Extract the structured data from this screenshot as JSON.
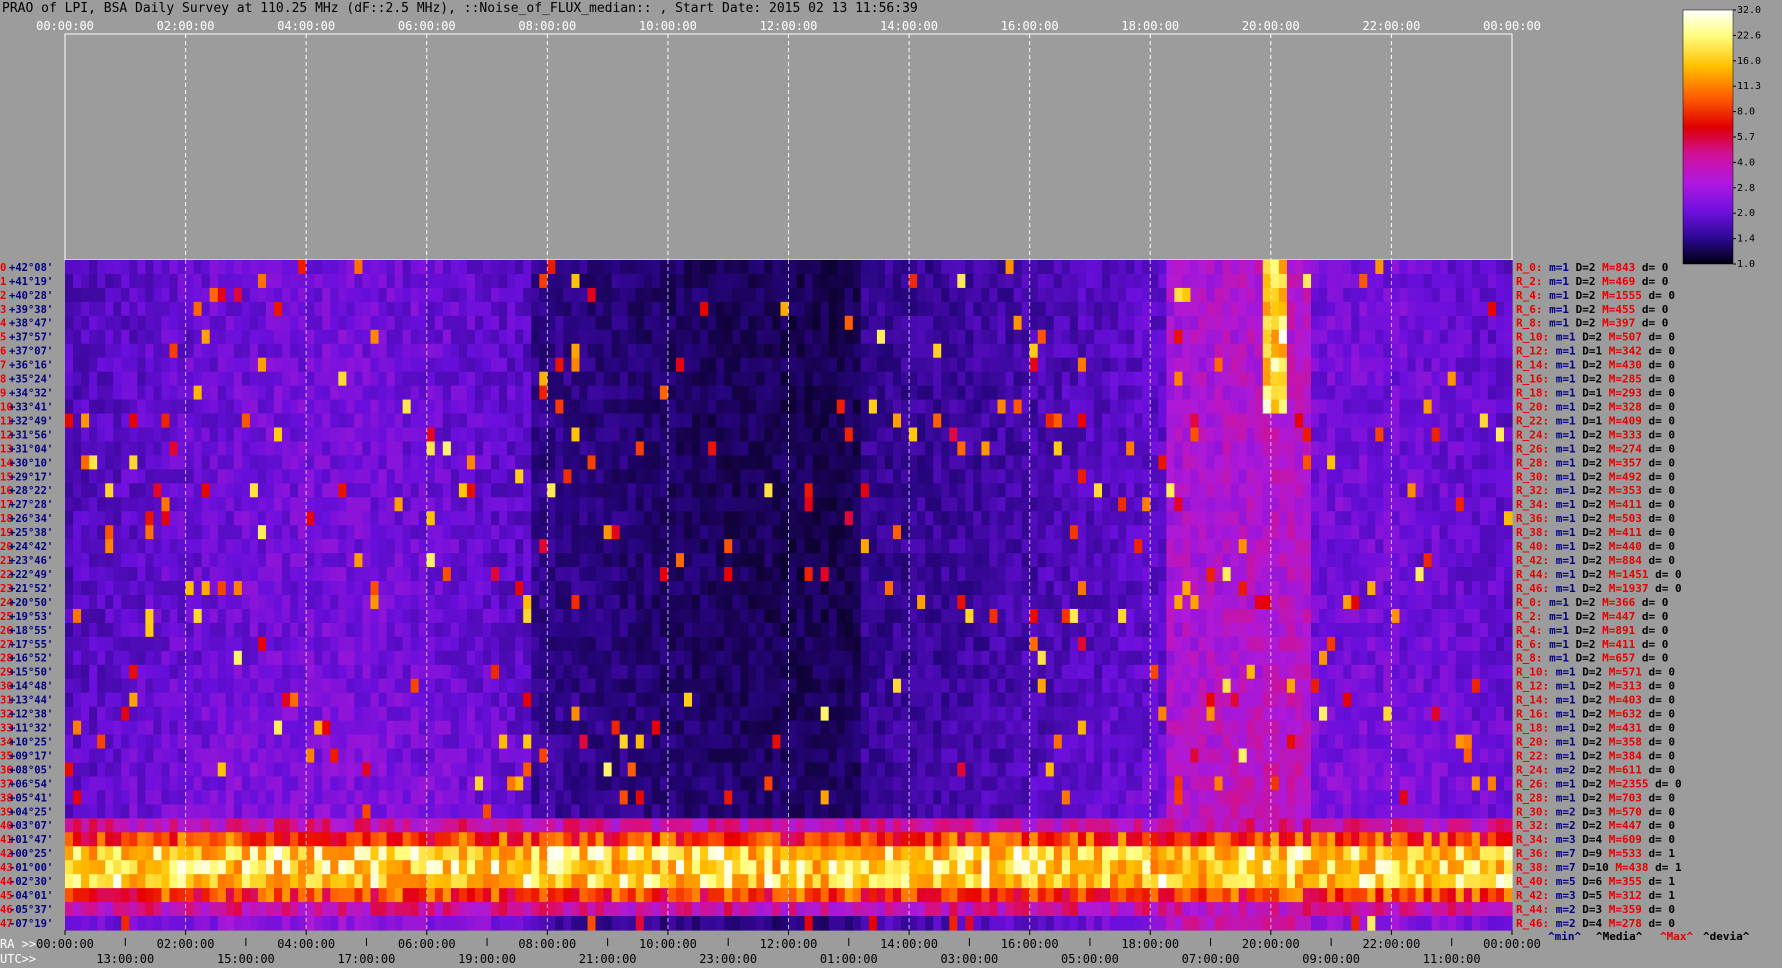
{
  "title": "PRAO of LPI, BSA Daily Survey at 110.25 MHz (dF::2.5 MHz), ::Noise_of_FLUX_median:: , Start Date: 2015 02 13 11:56:39",
  "chart_data": {
    "type": "heatmap",
    "title": "PRAO of LPI, BSA Daily Survey at 110.25 MHz (dF::2.5 MHz), ::Noise_of_FLUX_median:: , Start Date: 2015 02 13 11:56:39",
    "top_axis_ticks": [
      "00:00:00",
      "02:00:00",
      "04:00:00",
      "06:00:00",
      "08:00:00",
      "10:00:00",
      "12:00:00",
      "14:00:00",
      "16:00:00",
      "18:00:00",
      "20:00:00",
      "22:00:00",
      "00:00:00"
    ],
    "ra_axis_label": "RA >>",
    "ra_axis_ticks": [
      "00:00:00",
      "02:00:00",
      "04:00:00",
      "06:00:00",
      "08:00:00",
      "10:00:00",
      "12:00:00",
      "14:00:00",
      "16:00:00",
      "18:00:00",
      "20:00:00",
      "22:00:00",
      "00:00:00"
    ],
    "utc_axis_label": "UTC>>",
    "utc_axis_ticks": [
      "13:00:00",
      "15:00:00",
      "17:00:00",
      "19:00:00",
      "21:00:00",
      "23:00:00",
      "01:00:00",
      "03:00:00",
      "05:00:00",
      "07:00:00",
      "09:00:00",
      "11:00:00"
    ],
    "declination_labels": [
      "+42°08'",
      "+41°19'",
      "+40°28'",
      "+39°38'",
      "+38°47'",
      "+37°57'",
      "+37°07'",
      "+36°16'",
      "+35°24'",
      "+34°32'",
      "+33°41'",
      "+32°49'",
      "+31°56'",
      "+31°04'",
      "+30°10'",
      "+29°17'",
      "+28°22'",
      "+27°28'",
      "+26°34'",
      "+25°38'",
      "+24°42'",
      "+23°46'",
      "+22°49'",
      "+21°52'",
      "+20°50'",
      "+19°53'",
      "+18°55'",
      "+17°55'",
      "+16°52'",
      "+15°50'",
      "+14°48'",
      "+13°44'",
      "+12°38'",
      "+11°32'",
      "+10°25'",
      "+09°17'",
      "+08°05'",
      "+06°54'",
      "+05°41'",
      "+04°25'",
      "+03°07'",
      "+01°47'",
      "+00°25'",
      "-01°00'",
      "-02°30'",
      "-04°01'",
      "-05°37'",
      "-07°19'"
    ],
    "colorbar": {
      "ticks": [
        "32.0",
        "22.6",
        "16.0",
        "11.3",
        "8.0",
        "5.7",
        "4.0",
        "2.8",
        "2.0",
        "1.4",
        "1.0"
      ],
      "colors": [
        "#ffffff",
        "#ffff66",
        "#ffc000",
        "#ff6a00",
        "#ee0000",
        "#d0108a",
        "#b818d8",
        "#7a10e8",
        "#3c0890",
        "#0a0020"
      ]
    },
    "bright_band_declinations": [
      "+00°25'",
      "-01°00'",
      "-02°30'"
    ],
    "strong_source": {
      "ra": "20:00:00",
      "dec_range": [
        "+42°08'",
        "+31°04'"
      ]
    },
    "receiver_rows": [
      {
        "r": "R_0:",
        "m": "m=1",
        "d": "D=2",
        "max": "M=843",
        "dev": "d= 0"
      },
      {
        "r": "R_2:",
        "m": "m=1",
        "d": "D=2",
        "max": "M=469",
        "dev": "d= 0"
      },
      {
        "r": "R_4:",
        "m": "m=1",
        "d": "D=2",
        "max": "M=1555",
        "dev": "d= 0"
      },
      {
        "r": "R_6:",
        "m": "m=1",
        "d": "D=2",
        "max": "M=455",
        "dev": "d= 0"
      },
      {
        "r": "R_8:",
        "m": "m=1",
        "d": "D=2",
        "max": "M=397",
        "dev": "d= 0"
      },
      {
        "r": "R_10:",
        "m": "m=1",
        "d": "D=2",
        "max": "M=507",
        "dev": "d= 0"
      },
      {
        "r": "R_12:",
        "m": "m=1",
        "d": "D=1",
        "max": "M=342",
        "dev": "d= 0"
      },
      {
        "r": "R_14:",
        "m": "m=1",
        "d": "D=2",
        "max": "M=430",
        "dev": "d= 0"
      },
      {
        "r": "R_16:",
        "m": "m=1",
        "d": "D=2",
        "max": "M=285",
        "dev": "d= 0"
      },
      {
        "r": "R_18:",
        "m": "m=1",
        "d": "D=1",
        "max": "M=293",
        "dev": "d= 0"
      },
      {
        "r": "R_20:",
        "m": "m=1",
        "d": "D=2",
        "max": "M=328",
        "dev": "d= 0"
      },
      {
        "r": "R_22:",
        "m": "m=1",
        "d": "D=1",
        "max": "M=409",
        "dev": "d= 0"
      },
      {
        "r": "R_24:",
        "m": "m=1",
        "d": "D=2",
        "max": "M=333",
        "dev": "d= 0"
      },
      {
        "r": "R_26:",
        "m": "m=1",
        "d": "D=2",
        "max": "M=274",
        "dev": "d= 0"
      },
      {
        "r": "R_28:",
        "m": "m=1",
        "d": "D=2",
        "max": "M=357",
        "dev": "d= 0"
      },
      {
        "r": "R_30:",
        "m": "m=1",
        "d": "D=2",
        "max": "M=492",
        "dev": "d= 0"
      },
      {
        "r": "R_32:",
        "m": "m=1",
        "d": "D=2",
        "max": "M=353",
        "dev": "d= 0"
      },
      {
        "r": "R_34:",
        "m": "m=1",
        "d": "D=2",
        "max": "M=411",
        "dev": "d= 0"
      },
      {
        "r": "R_36:",
        "m": "m=1",
        "d": "D=2",
        "max": "M=503",
        "dev": "d= 0"
      },
      {
        "r": "R_38:",
        "m": "m=1",
        "d": "D=2",
        "max": "M=411",
        "dev": "d= 0"
      },
      {
        "r": "R_40:",
        "m": "m=1",
        "d": "D=2",
        "max": "M=440",
        "dev": "d= 0"
      },
      {
        "r": "R_42:",
        "m": "m=1",
        "d": "D=2",
        "max": "M=884",
        "dev": "d= 0"
      },
      {
        "r": "R_44:",
        "m": "m=1",
        "d": "D=2",
        "max": "M=1451",
        "dev": "d= 0"
      },
      {
        "r": "R_46:",
        "m": "m=1",
        "d": "D=2",
        "max": "M=1937",
        "dev": "d= 0"
      },
      {
        "r": "R_0:",
        "m": "m=1",
        "d": "D=2",
        "max": "M=366",
        "dev": "d= 0"
      },
      {
        "r": "R_2:",
        "m": "m=1",
        "d": "D=2",
        "max": "M=447",
        "dev": "d= 0"
      },
      {
        "r": "R_4:",
        "m": "m=1",
        "d": "D=2",
        "max": "M=891",
        "dev": "d= 0"
      },
      {
        "r": "R_6:",
        "m": "m=1",
        "d": "D=2",
        "max": "M=411",
        "dev": "d= 0"
      },
      {
        "r": "R_8:",
        "m": "m=1",
        "d": "D=2",
        "max": "M=657",
        "dev": "d= 0"
      },
      {
        "r": "R_10:",
        "m": "m=1",
        "d": "D=2",
        "max": "M=571",
        "dev": "d= 0"
      },
      {
        "r": "R_12:",
        "m": "m=1",
        "d": "D=2",
        "max": "M=313",
        "dev": "d= 0"
      },
      {
        "r": "R_14:",
        "m": "m=1",
        "d": "D=2",
        "max": "M=403",
        "dev": "d= 0"
      },
      {
        "r": "R_16:",
        "m": "m=1",
        "d": "D=2",
        "max": "M=632",
        "dev": "d= 0"
      },
      {
        "r": "R_18:",
        "m": "m=1",
        "d": "D=2",
        "max": "M=431",
        "dev": "d= 0"
      },
      {
        "r": "R_20:",
        "m": "m=1",
        "d": "D=2",
        "max": "M=358",
        "dev": "d= 0"
      },
      {
        "r": "R_22:",
        "m": "m=1",
        "d": "D=2",
        "max": "M=384",
        "dev": "d= 0"
      },
      {
        "r": "R_24:",
        "m": "m=2",
        "d": "D=2",
        "max": "M=611",
        "dev": "d= 0"
      },
      {
        "r": "R_26:",
        "m": "m=1",
        "d": "D=2",
        "max": "M=2355",
        "dev": "d= 0"
      },
      {
        "r": "R_28:",
        "m": "m=1",
        "d": "D=2",
        "max": "M=703",
        "dev": "d= 0"
      },
      {
        "r": "R_30:",
        "m": "m=2",
        "d": "D=3",
        "max": "M=570",
        "dev": "d= 0"
      },
      {
        "r": "R_32:",
        "m": "m=2",
        "d": "D=2",
        "max": "M=447",
        "dev": "d= 0"
      },
      {
        "r": "R_34:",
        "m": "m=3",
        "d": "D=4",
        "max": "M=609",
        "dev": "d= 0"
      },
      {
        "r": "R_36:",
        "m": "m=7",
        "d": "D=9",
        "max": "M=533",
        "dev": "d= 1"
      },
      {
        "r": "R_38:",
        "m": "m=7",
        "d": "D=10",
        "max": "M=438",
        "dev": "d= 1"
      },
      {
        "r": "R_40:",
        "m": "m=5",
        "d": "D=6",
        "max": "M=355",
        "dev": "d= 1"
      },
      {
        "r": "R_42:",
        "m": "m=3",
        "d": "D=5",
        "max": "M=312",
        "dev": "d= 1"
      },
      {
        "r": "R_44:",
        "m": "m=2",
        "d": "D=3",
        "max": "M=359",
        "dev": "d= 0"
      },
      {
        "r": "R_46:",
        "m": "m=2",
        "d": "D=4",
        "max": "M=278",
        "dev": "d= 0"
      }
    ],
    "bottom_legend": [
      "^min^",
      "^Media^",
      "^Max^",
      "^devia^"
    ],
    "colors": {
      "label_red": "#e80000",
      "label_navy": "#000080",
      "label_black": "#000000",
      "background": "#9c9c9c"
    }
  }
}
